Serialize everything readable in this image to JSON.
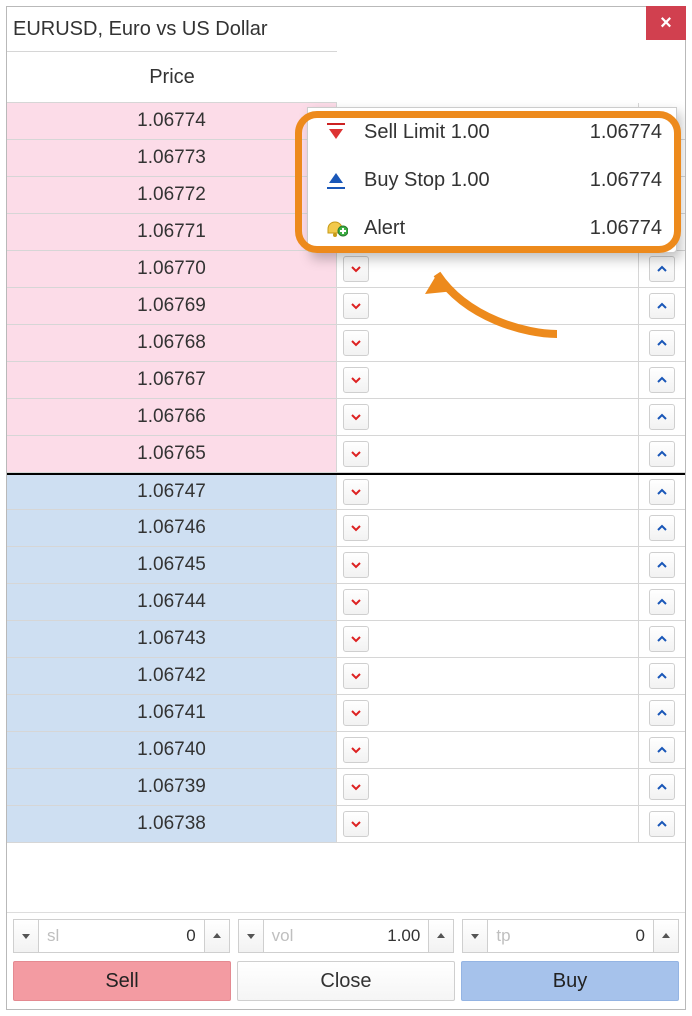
{
  "window": {
    "title": "EURUSD, Euro vs US Dollar",
    "close": "×"
  },
  "header": {
    "price_label": "Price"
  },
  "ask_rows": [
    {
      "price": "1.06774"
    },
    {
      "price": "1.06773"
    },
    {
      "price": "1.06772"
    },
    {
      "price": "1.06771"
    },
    {
      "price": "1.06770"
    },
    {
      "price": "1.06769"
    },
    {
      "price": "1.06768"
    },
    {
      "price": "1.06767"
    },
    {
      "price": "1.06766"
    },
    {
      "price": "1.06765"
    }
  ],
  "bid_rows": [
    {
      "price": "1.06747"
    },
    {
      "price": "1.06746"
    },
    {
      "price": "1.06745"
    },
    {
      "price": "1.06744"
    },
    {
      "price": "1.06743"
    },
    {
      "price": "1.06742"
    },
    {
      "price": "1.06741"
    },
    {
      "price": "1.06740"
    },
    {
      "price": "1.06739"
    },
    {
      "price": "1.06738"
    }
  ],
  "popup": {
    "items": [
      {
        "icon": "sell-limit",
        "label": "Sell Limit 1.00",
        "value": "1.06774"
      },
      {
        "icon": "buy-stop",
        "label": "Buy Stop 1.00",
        "value": "1.06774"
      },
      {
        "icon": "alert",
        "label": "Alert",
        "value": "1.06774"
      }
    ]
  },
  "bottom": {
    "sl": {
      "label": "sl",
      "value": "0"
    },
    "vol": {
      "label": "vol",
      "value": "1.00"
    },
    "tp": {
      "label": "tp",
      "value": "0"
    },
    "sell": "Sell",
    "close": "Close",
    "buy": "Buy"
  }
}
